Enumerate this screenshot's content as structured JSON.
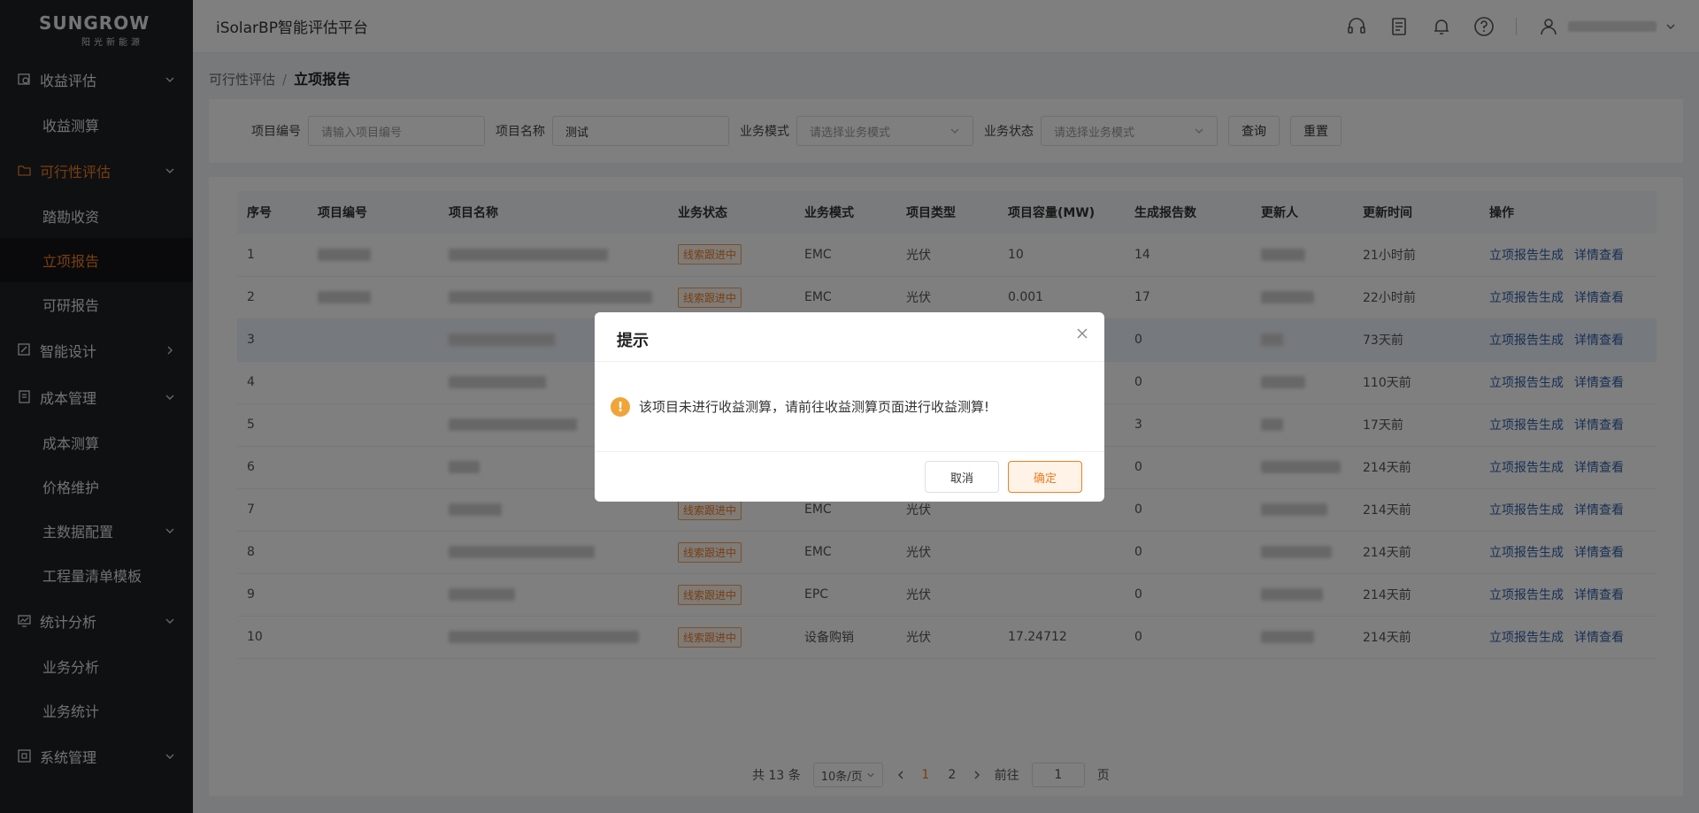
{
  "brand": {
    "name": "SUNGROW",
    "sub": "阳光新能源"
  },
  "header": {
    "title": "iSolarBP智能评估平台"
  },
  "sidebar": {
    "groups": [
      {
        "label": "收益评估",
        "items": [
          "收益测算"
        ]
      },
      {
        "label": "可行性评估",
        "items": [
          "踏勘收资",
          "立项报告",
          "可研报告"
        ]
      },
      {
        "label": "智能设计"
      },
      {
        "label": "成本管理",
        "items": [
          "成本测算",
          "价格维护",
          "主数据配置",
          "工程量清单模板"
        ]
      },
      {
        "label": "统计分析",
        "items": [
          "业务分析",
          "业务统计"
        ]
      },
      {
        "label": "系统管理"
      }
    ]
  },
  "breadcrumb": {
    "parent": "可行性评估",
    "sep": "/",
    "current": "立项报告"
  },
  "search": {
    "code_label": "项目编号",
    "code_placeholder": "请输入项目编号",
    "name_label": "项目名称",
    "name_value": "测试",
    "mode_label": "业务模式",
    "mode_placeholder": "请选择业务模式",
    "status_label": "业务状态",
    "status_placeholder": "请选择业务模式",
    "query": "查询",
    "reset": "重置"
  },
  "table": {
    "headers": [
      "序号",
      "项目编号",
      "项目名称",
      "业务状态",
      "业务模式",
      "项目类型",
      "项目容量(MW)",
      "生成报告数",
      "更新人",
      "更新时间",
      "操作"
    ],
    "rows": [
      {
        "no": "1",
        "status": "线索跟进中",
        "mode": "EMC",
        "type": "光伏",
        "cap": "10",
        "reports": "14",
        "time": "21小时前"
      },
      {
        "no": "2",
        "status": "线索跟进中",
        "mode": "EMC",
        "type": "光伏",
        "cap": "0.001",
        "reports": "17",
        "time": "22小时前"
      },
      {
        "no": "3",
        "status": "",
        "mode": "",
        "type": "",
        "cap": "",
        "reports": "0",
        "time": "73天前"
      },
      {
        "no": "4",
        "status": "",
        "mode": "",
        "type": "",
        "cap": "",
        "reports": "0",
        "time": "110天前"
      },
      {
        "no": "5",
        "status": "",
        "mode": "",
        "type": "",
        "cap": "",
        "reports": "3",
        "time": "17天前"
      },
      {
        "no": "6",
        "status": "",
        "mode": "",
        "type": "",
        "cap": "",
        "reports": "0",
        "time": "214天前"
      },
      {
        "no": "7",
        "status": "线索跟进中",
        "mode": "EMC",
        "type": "光伏",
        "cap": "",
        "reports": "0",
        "time": "214天前"
      },
      {
        "no": "8",
        "status": "线索跟进中",
        "mode": "EMC",
        "type": "光伏",
        "cap": "",
        "reports": "0",
        "time": "214天前"
      },
      {
        "no": "9",
        "status": "线索跟进中",
        "mode": "EPC",
        "type": "光伏",
        "cap": "",
        "reports": "0",
        "time": "214天前"
      },
      {
        "no": "10",
        "status": "线索跟进中",
        "mode": "设备购销",
        "type": "光伏",
        "cap": "17.24712",
        "reports": "0",
        "time": "214天前"
      }
    ],
    "action_generate": "立项报告生成",
    "action_detail": "详情查看"
  },
  "pagination": {
    "total": "共 13 条",
    "page_size": "10条/页",
    "pages": [
      "1",
      "2"
    ],
    "current": "1",
    "goto_label": "前往",
    "goto_value": "1",
    "page_suffix": "页"
  },
  "dialog": {
    "title": "提示",
    "message": "该项目未进行收益测算，请前往收益测算页面进行收益测算!",
    "cancel": "取消",
    "confirm": "确定"
  },
  "colors": {
    "accent": "#f07d22",
    "sidebar_bg": "#1f2125",
    "link": "#2f5fa8",
    "warn": "#f0a43a"
  }
}
